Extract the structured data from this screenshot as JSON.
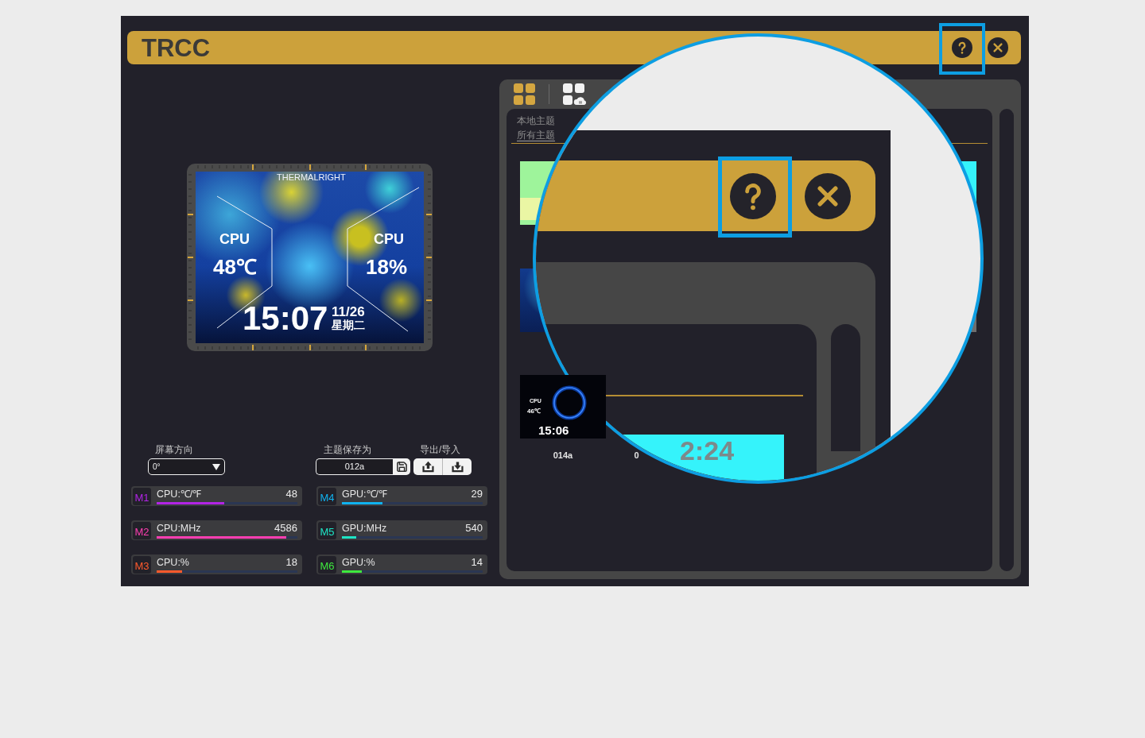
{
  "title_bar": {
    "title": "TRCC",
    "buttons": [
      {
        "kind": "help",
        "highlighted": true
      },
      {
        "kind": "close",
        "highlighted": false
      }
    ]
  },
  "preview": {
    "brand": "THERMALRIGHT",
    "gauges": [
      {
        "label": "CPU",
        "value": "48℃"
      },
      {
        "label": "CPU",
        "value": "18%"
      }
    ],
    "time": "15:07",
    "date": "11/26",
    "weekday": "星期二"
  },
  "screen_orientation": {
    "label": "屏幕方向",
    "value": "0°"
  },
  "save_theme": {
    "label": "主题保存为",
    "value": "012a"
  },
  "export_import": {
    "label": "导出/导入"
  },
  "metrics": [
    {
      "slot": "M1",
      "name": "CPU:℃/℉",
      "value": "48",
      "level": 0.48,
      "color": "#b224e6"
    },
    {
      "slot": "M2",
      "name": "CPU:MHz",
      "value": "4586",
      "level": 0.92,
      "color": "#ff3fb2"
    },
    {
      "slot": "M3",
      "name": "CPU:%",
      "value": "18",
      "level": 0.18,
      "color": "#ff5a2c"
    },
    {
      "slot": "M4",
      "name": "GPU:℃/℉",
      "value": "29",
      "level": 0.29,
      "color": "#10b2ef"
    },
    {
      "slot": "M5",
      "name": "GPU:MHz",
      "value": "540",
      "level": 0.1,
      "color": "#1ee5c5"
    },
    {
      "slot": "M6",
      "name": "GPU:%",
      "value": "14",
      "level": 0.14,
      "color": "#3ee83e"
    }
  ],
  "theme_panel": {
    "toolbar": [
      {
        "kind": "grid",
        "selected": true
      },
      {
        "kind": "cloud-grid",
        "selected": false
      }
    ],
    "tabs": [
      {
        "label": "本地主题",
        "selected": false
      },
      {
        "label": "所有主题",
        "selected": true
      }
    ],
    "thumbnails": [
      [
        {
          "kind": "mint"
        },
        {
          "kind": "cyan"
        }
      ],
      [
        {
          "kind": "starry"
        },
        {
          "kind": "gray"
        }
      ],
      [
        {
          "kind": "ring",
          "name": "014a",
          "gauge_label": "CPU",
          "gauge_value": "46℃",
          "clock": "15:06"
        },
        {
          "name": "0"
        }
      ]
    ]
  },
  "magnifier": {
    "thumbnail_clock": "2:24"
  }
}
